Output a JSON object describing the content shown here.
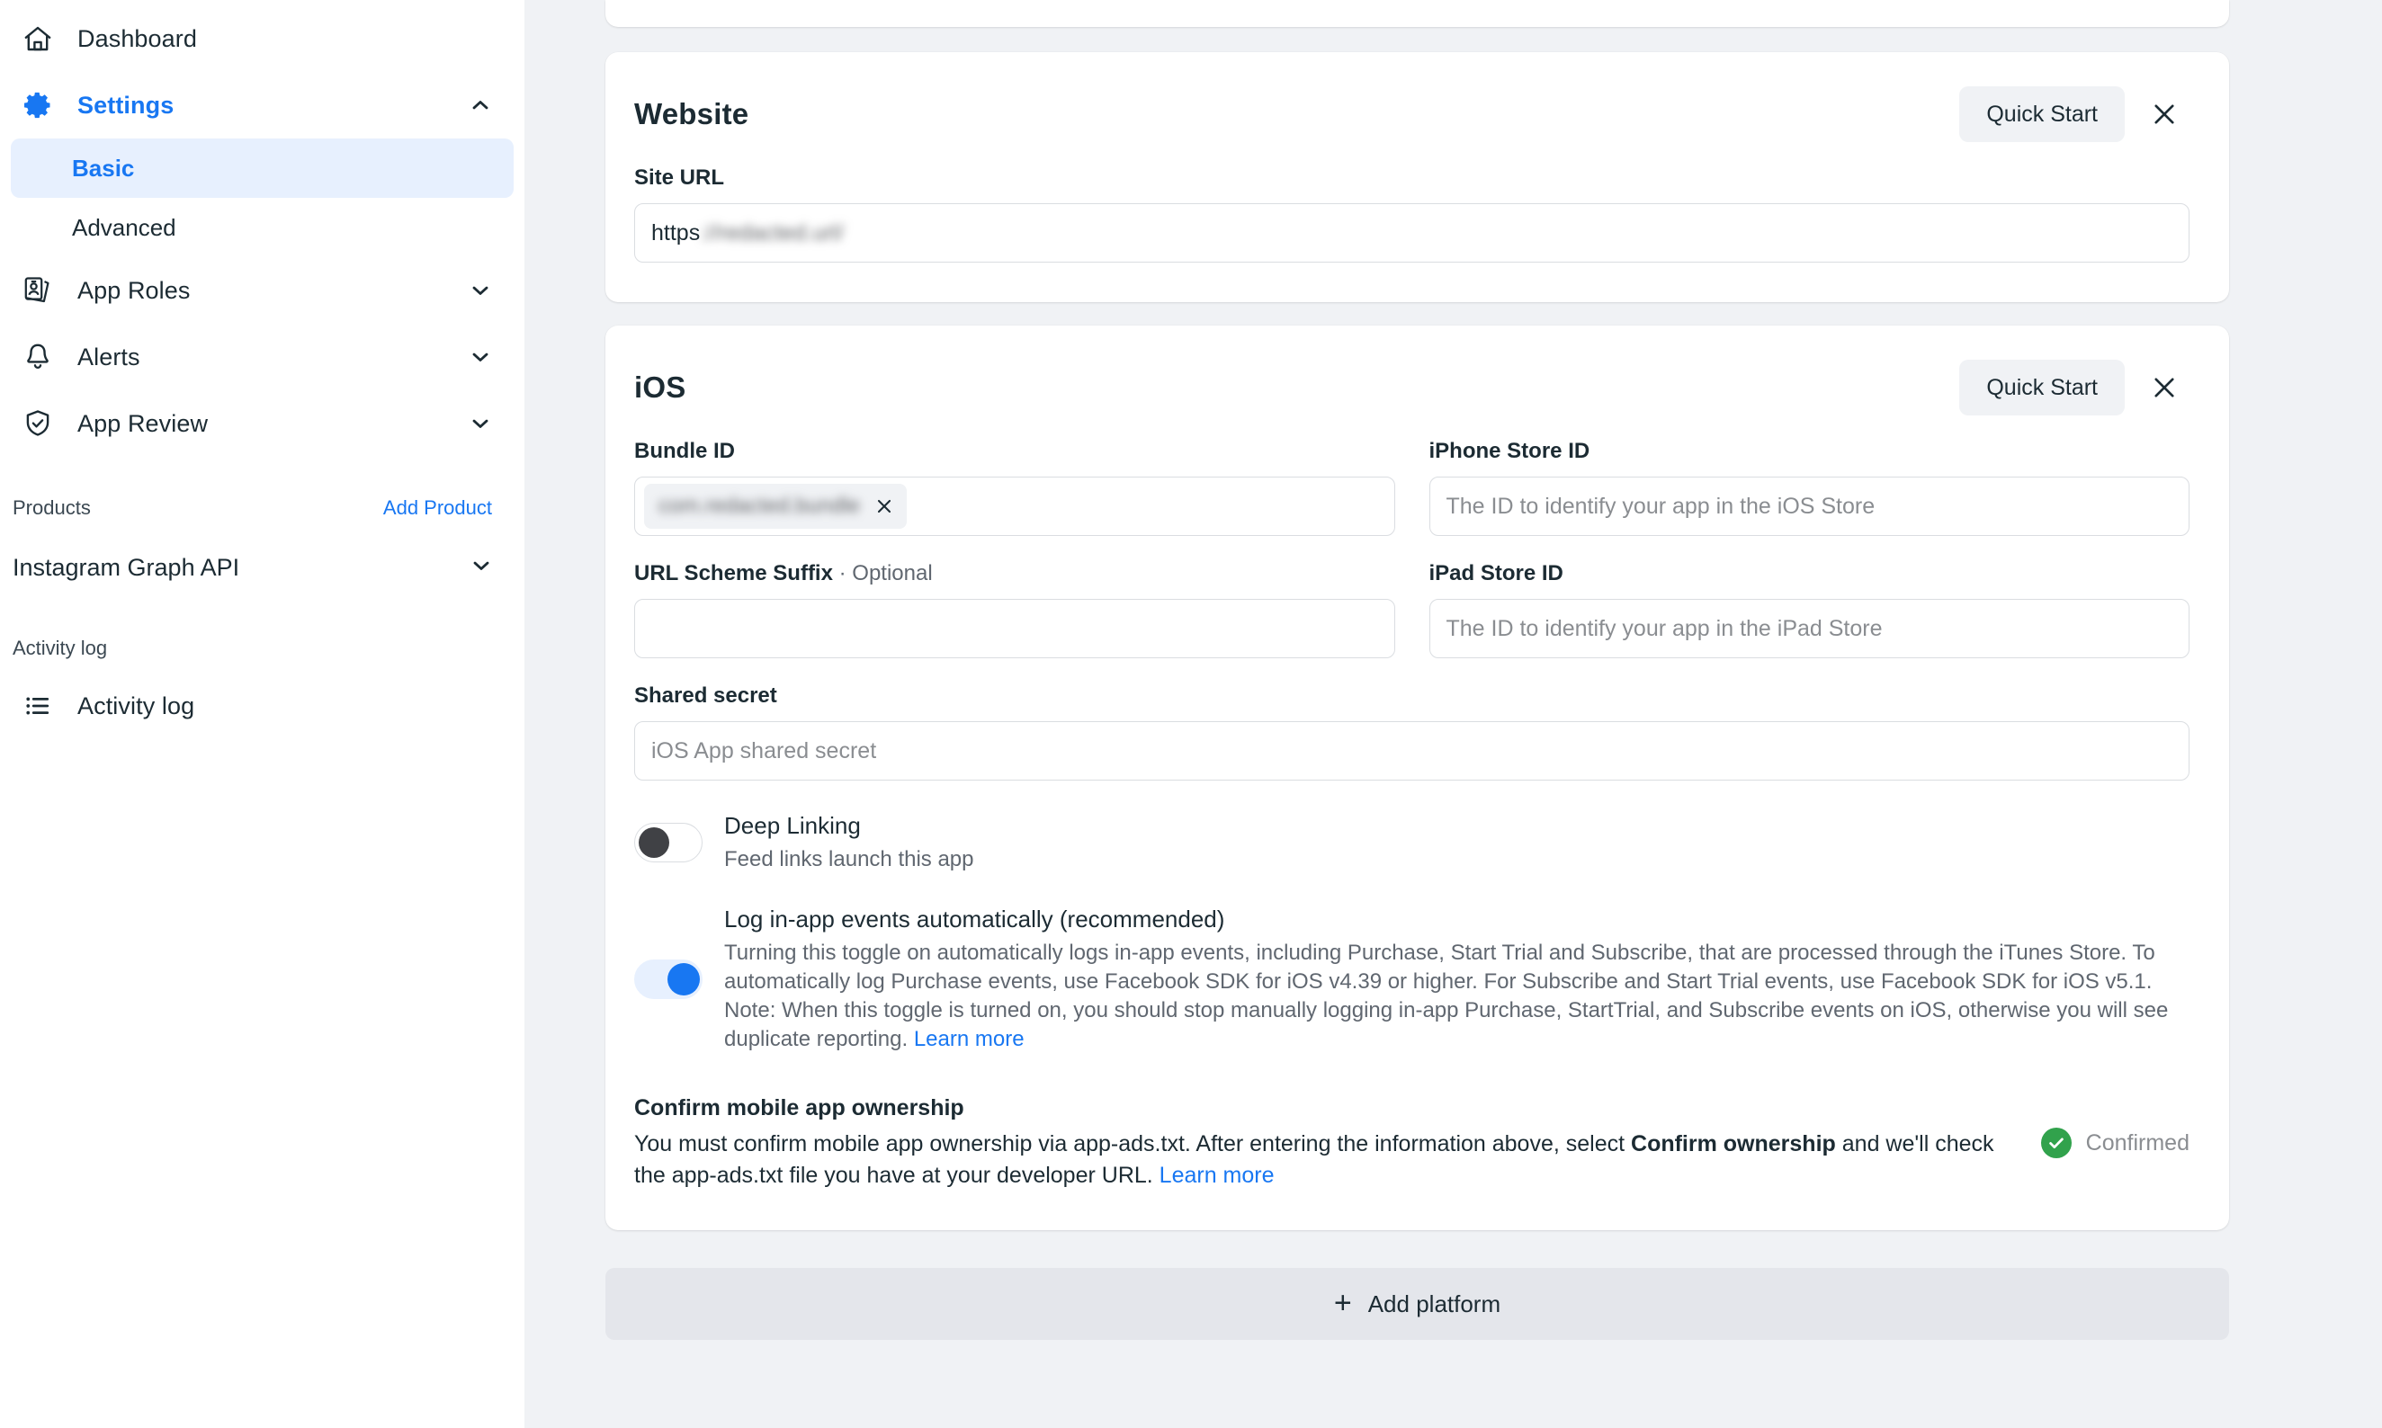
{
  "colors": {
    "accent": "#1877f2",
    "accent_soft": "#e7f0fe",
    "page_bg": "#f0f2f5",
    "text": "#1c2b33",
    "muted": "#606770",
    "placeholder": "#8a8d91",
    "success": "#31a24c",
    "add_platform_bg": "#e4e6eb"
  },
  "sidebar": {
    "items": [
      {
        "label": "Dashboard",
        "icon": "home-icon",
        "chevron": null,
        "active": false
      },
      {
        "label": "Settings",
        "icon": "gear-icon",
        "chevron": "chevron-up-icon",
        "active": true
      },
      {
        "label": "App Roles",
        "icon": "id-card-icon",
        "chevron": "chevron-down-icon",
        "active": false
      },
      {
        "label": "Alerts",
        "icon": "bell-icon",
        "chevron": "chevron-down-icon",
        "active": false
      },
      {
        "label": "App Review",
        "icon": "shield-check-icon",
        "chevron": "chevron-down-icon",
        "active": false
      }
    ],
    "settings_children": [
      {
        "label": "Basic",
        "selected": true
      },
      {
        "label": "Advanced",
        "selected": false
      }
    ],
    "products_header": {
      "title": "Products",
      "action": "Add Product"
    },
    "products": [
      {
        "label": "Instagram Graph API",
        "chevron": "chevron-down-icon"
      }
    ],
    "activity_section_label": "Activity log",
    "activity_item": {
      "label": "Activity log",
      "icon": "list-icon"
    }
  },
  "main": {
    "website_card": {
      "title": "Website",
      "quick_start_label": "Quick Start",
      "close_icon": "close-icon",
      "site_url": {
        "label": "Site URL",
        "value_prefix": "https",
        "value_redacted": "://redacted.url/",
        "redacted": true
      }
    },
    "ios_card": {
      "title": "iOS",
      "quick_start_label": "Quick Start",
      "close_icon": "close-icon",
      "bundle_id": {
        "label": "Bundle ID",
        "chip_value_redacted": "com.redacted.bundle",
        "chip_redacted": true,
        "remove_icon": "close-icon"
      },
      "iphone_store_id": {
        "label": "iPhone Store ID",
        "value": "",
        "placeholder": "The ID to identify your app in the iOS Store"
      },
      "url_scheme_suffix": {
        "label": "URL Scheme Suffix",
        "optional_suffix": " · Optional",
        "value": "",
        "placeholder": ""
      },
      "ipad_store_id": {
        "label": "iPad Store ID",
        "value": "",
        "placeholder": "The ID to identify your app in the iPad Store"
      },
      "shared_secret": {
        "label": "Shared secret",
        "value": "",
        "placeholder": "iOS App shared secret"
      },
      "deep_linking": {
        "title": "Deep Linking",
        "subtitle": "Feed links launch this app",
        "state": "off"
      },
      "log_events": {
        "title": "Log in-app events automatically (recommended)",
        "description": "Turning this toggle on automatically logs in-app events, including Purchase, Start Trial and Subscribe, that are processed through the iTunes Store. To automatically log Purchase events, use Facebook SDK for iOS v4.39 or higher. For Subscribe and Start Trial events, use Facebook SDK for iOS v5.1. Note: When this toggle is turned on, you should stop manually logging in-app Purchase, StartTrial, and Subscribe events on iOS, otherwise you will see duplicate reporting.",
        "learn_more": "Learn more",
        "state": "on"
      },
      "ownership": {
        "title": "Confirm mobile app ownership",
        "body_part1": "You must confirm mobile app ownership via app-ads.txt. After entering the information above, select ",
        "body_bold": "Confirm ownership",
        "body_part2": " and we'll check the app-ads.txt file you have at your developer URL. ",
        "learn_more": "Learn more",
        "status_label": "Confirmed",
        "status_icon": "check-circle-icon"
      }
    },
    "add_platform": {
      "label": "Add platform",
      "icon": "plus-icon"
    }
  }
}
